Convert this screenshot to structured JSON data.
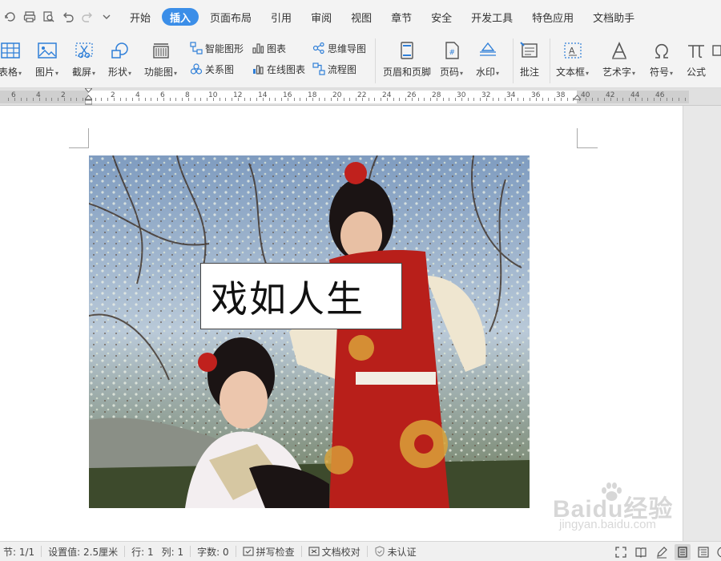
{
  "menubar": {
    "tabs": [
      {
        "label": "开始",
        "active": false
      },
      {
        "label": "插入",
        "active": true
      },
      {
        "label": "页面布局",
        "active": false
      },
      {
        "label": "引用",
        "active": false
      },
      {
        "label": "审阅",
        "active": false
      },
      {
        "label": "视图",
        "active": false
      },
      {
        "label": "章节",
        "active": false
      },
      {
        "label": "安全",
        "active": false
      },
      {
        "label": "开发工具",
        "active": false
      },
      {
        "label": "特色应用",
        "active": false
      },
      {
        "label": "文档助手",
        "active": false
      }
    ]
  },
  "ribbon": {
    "table": "表格",
    "picture": "图片",
    "screenshot": "截屏",
    "shape": "形状",
    "function_chart": "功能图",
    "smart_graphic": "智能图形",
    "chart": "图表",
    "mind_map": "思维导图",
    "relation_chart": "关系图",
    "online_chart": "在线图表",
    "flowchart": "流程图",
    "header_footer": "页眉和页脚",
    "page_number": "页码",
    "watermark": "水印",
    "comment": "批注",
    "textbox": "文本框",
    "wordart": "艺术字",
    "symbol": "符号",
    "formula": "公式"
  },
  "ruler": {
    "labels": [
      "6",
      "4",
      "2",
      "2",
      "4",
      "6",
      "8",
      "10",
      "12",
      "14",
      "16",
      "18",
      "20",
      "22",
      "24",
      "26",
      "28",
      "30",
      "32",
      "34",
      "36",
      "38",
      "40",
      "42",
      "44",
      "46"
    ]
  },
  "document": {
    "caption": "戏如人生"
  },
  "watermark": {
    "brand": "Baidu经验",
    "url": "jingyan.baidu.com"
  },
  "statusbar": {
    "section": "节: 1/1",
    "setting": "设置值: 2.5厘米",
    "row": "行: 1",
    "col": "列: 1",
    "wordcount": "字数: 0",
    "spellcheck": "拼写检查",
    "proofread": "文档校对",
    "uncertified": "未认证"
  },
  "colors": {
    "accent": "#3b8ee8",
    "icon_blue": "#2f7fd8"
  }
}
